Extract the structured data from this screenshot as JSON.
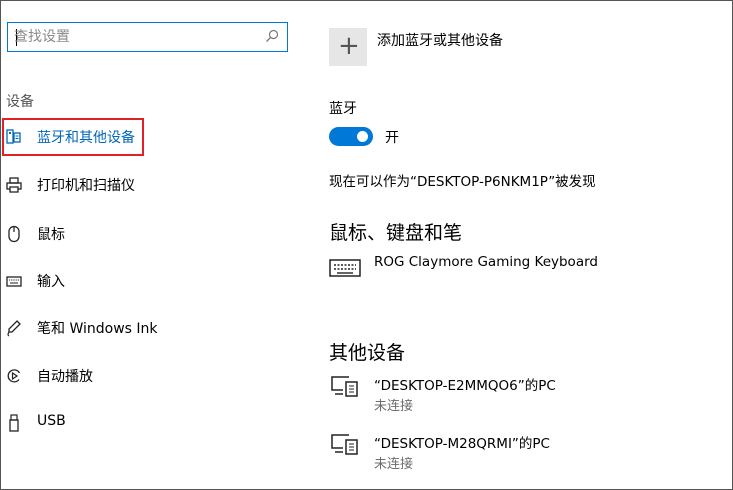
{
  "search": {
    "placeholder": "查找设置"
  },
  "sidebar": {
    "section": "设备",
    "items": [
      {
        "label": "蓝牙和其他设备",
        "icon": "bluetooth-devices-icon",
        "active": true
      },
      {
        "label": "打印机和扫描仪",
        "icon": "printer-icon"
      },
      {
        "label": "鼠标",
        "icon": "mouse-icon"
      },
      {
        "label": "输入",
        "icon": "keyboard-icon"
      },
      {
        "label": "笔和 Windows Ink",
        "icon": "pen-icon"
      },
      {
        "label": "自动播放",
        "icon": "autoplay-icon"
      },
      {
        "label": "USB",
        "icon": "usb-icon"
      }
    ]
  },
  "main": {
    "add_device_label": "添加蓝牙或其他设备",
    "bluetooth": {
      "title": "蓝牙",
      "toggle_state": "开",
      "on": true,
      "discoverable_text": "现在可以作为“DESKTOP-P6NKM1P”被发现"
    },
    "mouse_keyboard": {
      "heading": "鼠标、键盘和笔",
      "devices": [
        {
          "name": "ROG Claymore Gaming Keyboard",
          "icon": "keyboard-icon"
        }
      ]
    },
    "other_devices": {
      "heading": "其他设备",
      "devices": [
        {
          "name": "“DESKTOP-E2MMQO6”的PC",
          "status": "未连接",
          "icon": "pc-device-icon"
        },
        {
          "name": "“DESKTOP-M28QRMI”的PC",
          "status": "未连接",
          "icon": "pc-device-icon"
        }
      ]
    }
  },
  "colors": {
    "accent": "#0078d7",
    "active_text": "#0067b8",
    "highlight_border": "#e0212a"
  }
}
